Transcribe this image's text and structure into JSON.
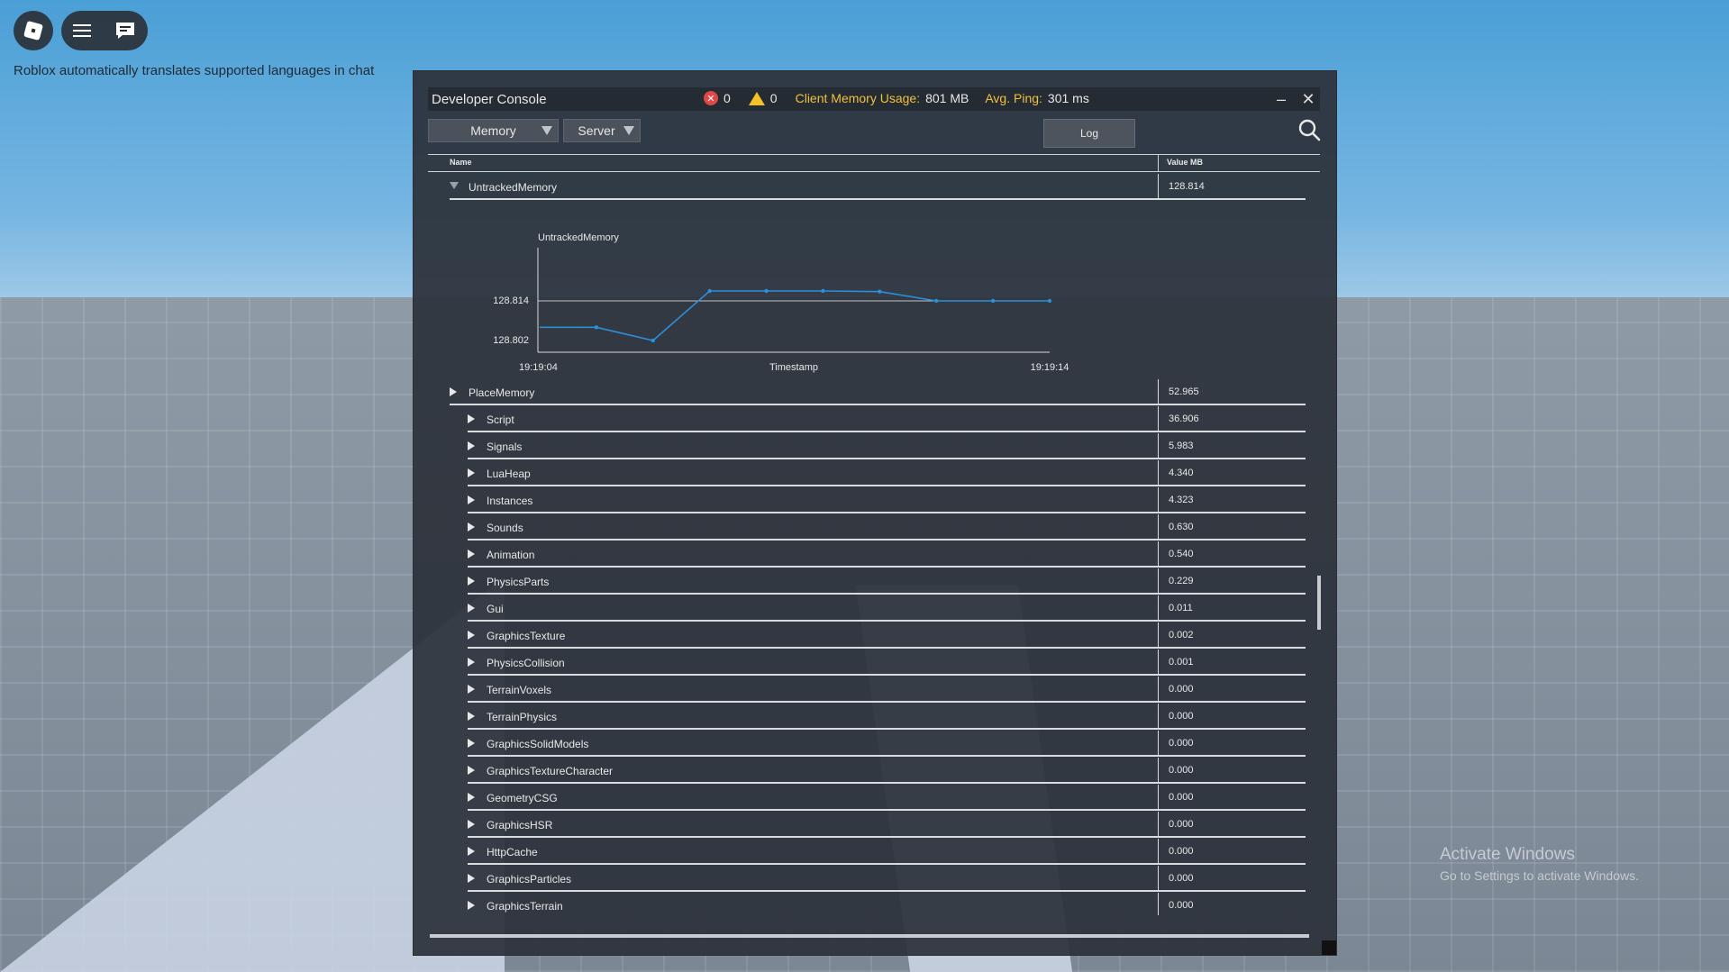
{
  "top_controls": {
    "note": "Roblox automatically translates supported languages in chat"
  },
  "console": {
    "title": "Developer Console",
    "error_count": "0",
    "warning_count": "0",
    "client_memory_label": "Client Memory Usage:",
    "client_memory_value": "801 MB",
    "ping_label": "Avg. Ping:",
    "ping_value": "301 ms",
    "dropdown_view": "Memory",
    "dropdown_target": "Server",
    "log_button": "Log",
    "columns": {
      "name": "Name",
      "value": "Value MB"
    },
    "expanded_row": {
      "name": "UntrackedMemory",
      "value": "128.814"
    },
    "graph": {
      "title": "UntrackedMemory",
      "xlabel": "Timestamp",
      "x_start": "19:19:04",
      "x_end": "19:19:14",
      "y_ticks": [
        "128.814",
        "128.802"
      ],
      "y_tick_values": [
        128.814,
        128.802
      ],
      "values": [
        128.806,
        128.806,
        128.802,
        128.817,
        128.817,
        128.817,
        128.8168,
        128.814,
        128.814,
        128.814
      ]
    },
    "place_row": {
      "name": "PlaceMemory",
      "value": "52.965"
    },
    "children": [
      {
        "name": "Script",
        "value": "36.906"
      },
      {
        "name": "Signals",
        "value": "5.983"
      },
      {
        "name": "LuaHeap",
        "value": "4.340"
      },
      {
        "name": "Instances",
        "value": "4.323"
      },
      {
        "name": "Sounds",
        "value": "0.630"
      },
      {
        "name": "Animation",
        "value": "0.540"
      },
      {
        "name": "PhysicsParts",
        "value": "0.229"
      },
      {
        "name": "Gui",
        "value": "0.011"
      },
      {
        "name": "GraphicsTexture",
        "value": "0.002"
      },
      {
        "name": "PhysicsCollision",
        "value": "0.001"
      },
      {
        "name": "TerrainVoxels",
        "value": "0.000"
      },
      {
        "name": "TerrainPhysics",
        "value": "0.000"
      },
      {
        "name": "GraphicsSolidModels",
        "value": "0.000"
      },
      {
        "name": "GraphicsTextureCharacter",
        "value": "0.000"
      },
      {
        "name": "GeometryCSG",
        "value": "0.000"
      },
      {
        "name": "GraphicsHSR",
        "value": "0.000"
      },
      {
        "name": "HttpCache",
        "value": "0.000"
      },
      {
        "name": "GraphicsParticles",
        "value": "0.000"
      },
      {
        "name": "GraphicsTerrain",
        "value": "0.000"
      }
    ]
  },
  "watermark": {
    "line1": "Activate Windows",
    "line2": "Go to Settings to activate Windows."
  },
  "colors": {
    "graph_line": "#2d8fd8",
    "stat_label": "#f0c040"
  }
}
